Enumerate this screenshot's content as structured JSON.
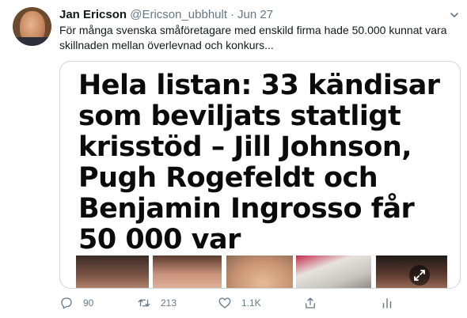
{
  "tweet": {
    "author_name": "Jan Ericson",
    "handle": "@Ericson_ubbhult",
    "separator": "·",
    "date": "Jun 27",
    "text": "För många svenska småföretagare med enskild firma hade 50.000 kunnat vara skillnaden mellan överlevnad och konkurs..."
  },
  "card": {
    "headline": "Hela listan: 33 kändisar som beviljats statligt krisstöd – Jill Johnson, Pugh Rogefeldt och Benjamin Ingrosso får 50 000 var"
  },
  "actions": {
    "replies": "90",
    "retweets": "213",
    "likes": "1.1K"
  },
  "icons": {
    "caret": "chevron-down-icon",
    "reply": "reply-icon",
    "retweet": "retweet-icon",
    "like": "heart-icon",
    "share": "share-icon",
    "analytics": "analytics-icon",
    "expand": "expand-icon"
  },
  "colors": {
    "name": "#14171a",
    "secondary": "#657786",
    "border": "#ccd6dd"
  }
}
